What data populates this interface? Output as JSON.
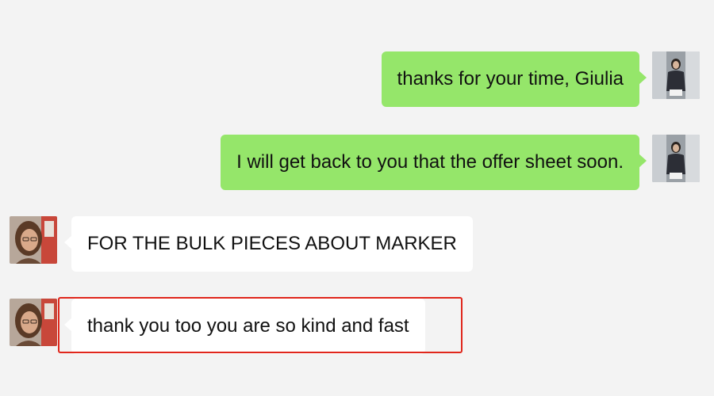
{
  "messages": [
    {
      "sender": "me",
      "avatar_icon": "user-avatar-icon",
      "text": "thanks for your time, Giulia"
    },
    {
      "sender": "me",
      "avatar_icon": "user-avatar-icon",
      "text": "I will get back to you that the offer sheet soon."
    },
    {
      "sender": "contact",
      "avatar_icon": "contact-avatar-icon",
      "text": "FOR THE BULK PIECES ABOUT MARKER"
    },
    {
      "sender": "contact",
      "avatar_icon": "contact-avatar-icon",
      "text": "thank you too you are so kind and fast",
      "highlighted": true
    }
  ],
  "colors": {
    "background": "#f3f3f3",
    "my_bubble": "#95e66a",
    "contact_bubble": "#ffffff",
    "highlight_border": "#e0261b"
  }
}
